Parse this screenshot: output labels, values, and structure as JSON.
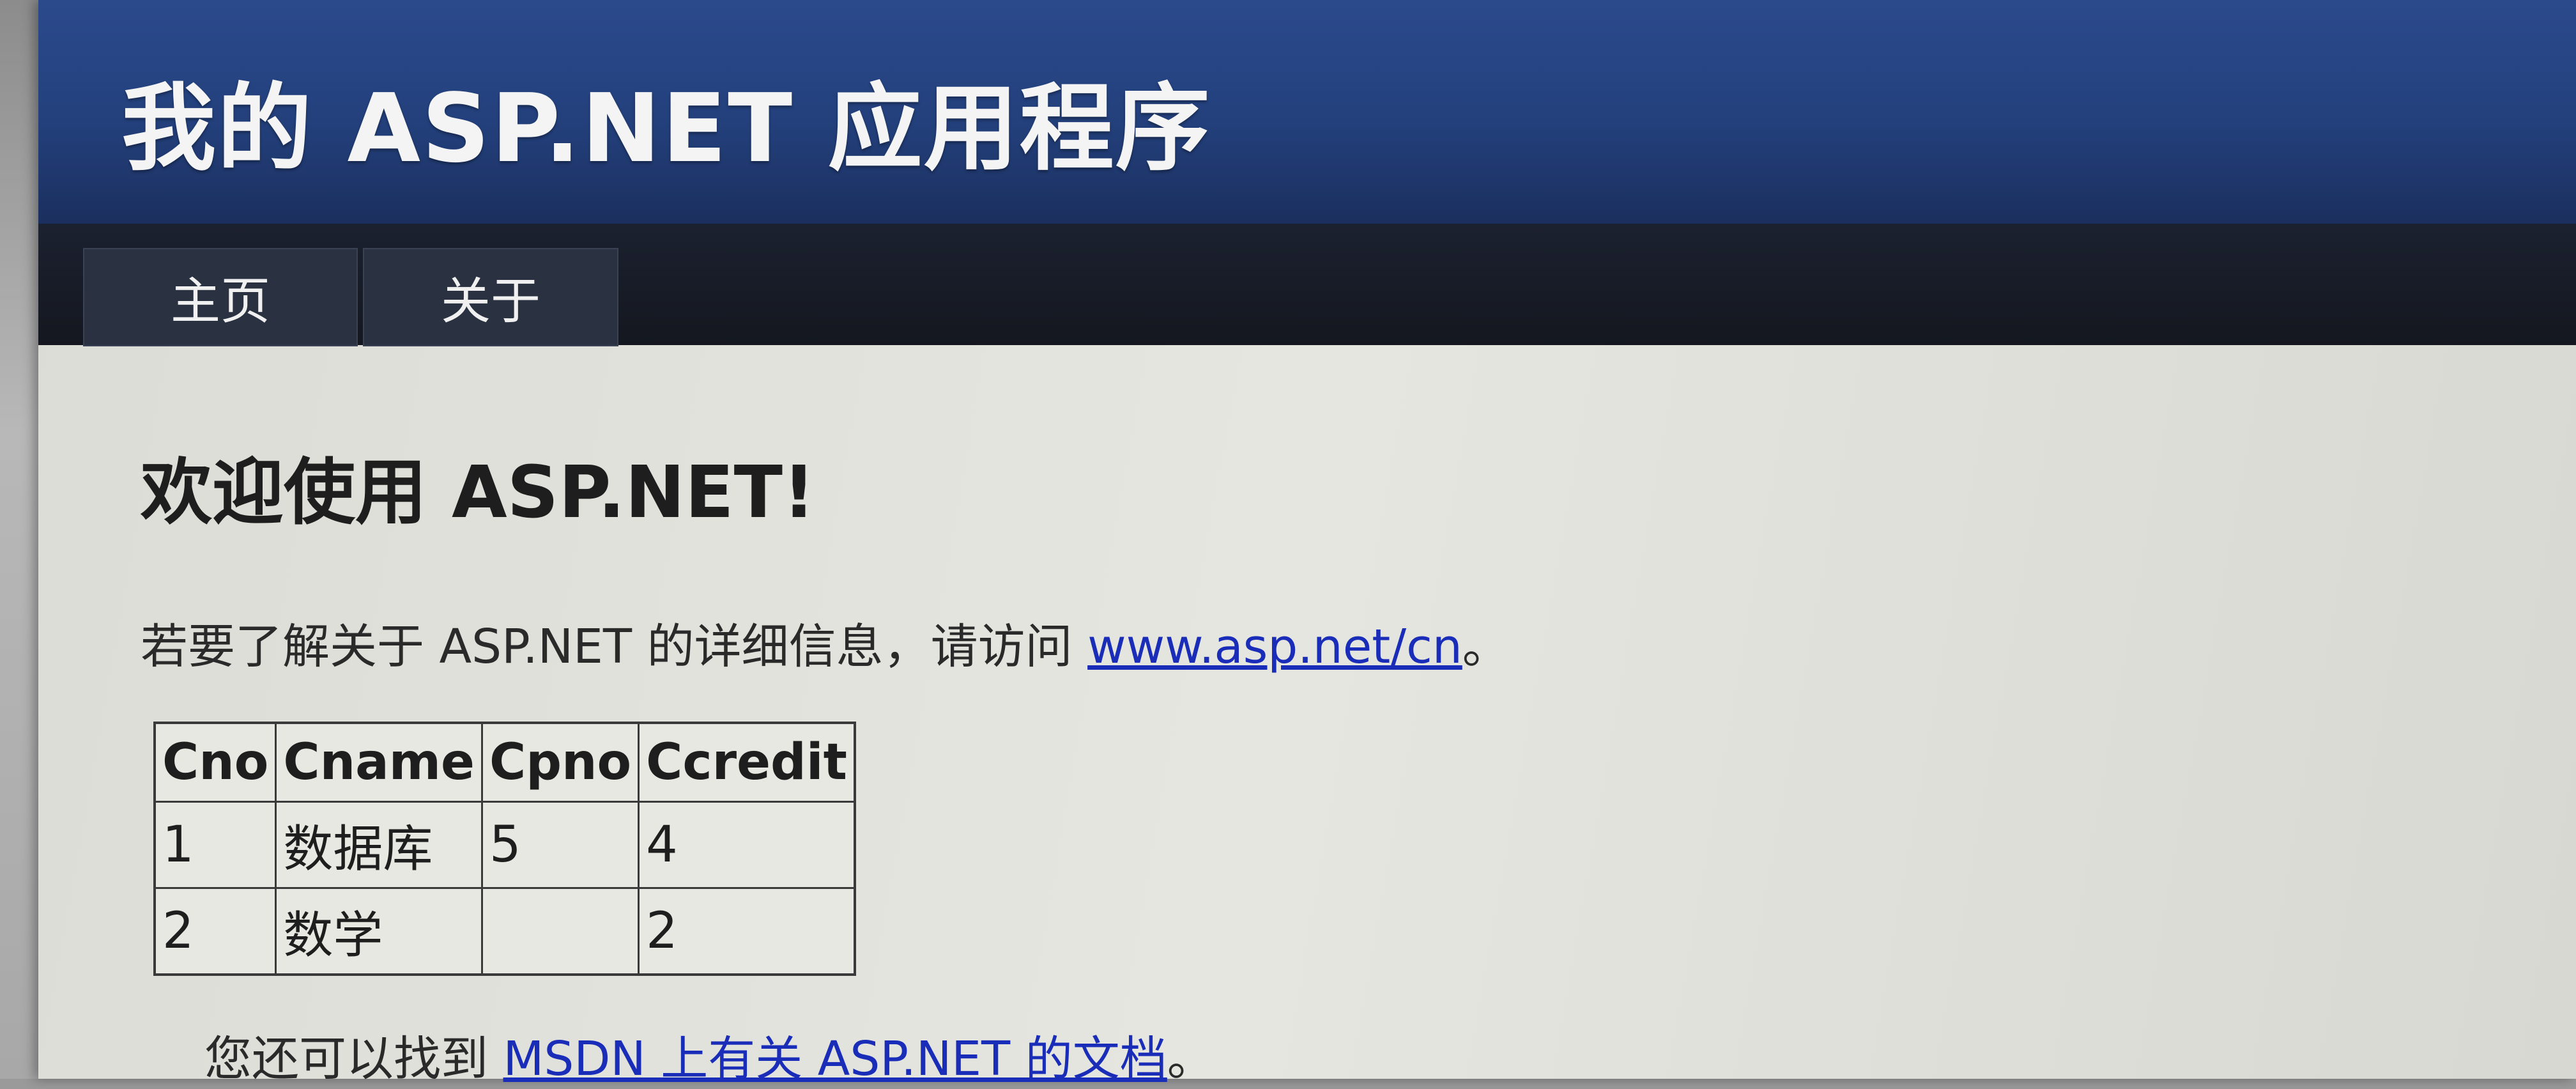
{
  "header": {
    "title": "我的 ASP.NET 应用程序"
  },
  "menu": {
    "items": [
      {
        "label": "主页"
      },
      {
        "label": "关于"
      }
    ]
  },
  "main": {
    "heading": "欢迎使用 ASP.NET!",
    "intro_text": "若要了解关于 ASP.NET 的详细信息，请访问 ",
    "intro_link": "www.asp.net/cn",
    "intro_end": "。",
    "table": {
      "columns": [
        "Cno",
        "Cname",
        "Cpno",
        "Ccredit"
      ],
      "rows": [
        [
          "1",
          "数据库",
          "5",
          "4"
        ],
        [
          "2",
          "数学",
          "",
          "2"
        ]
      ]
    },
    "footer_text": "您还可以找到 ",
    "footer_link": "MSDN 上有关 ASP.NET 的文档",
    "footer_end": "。"
  }
}
